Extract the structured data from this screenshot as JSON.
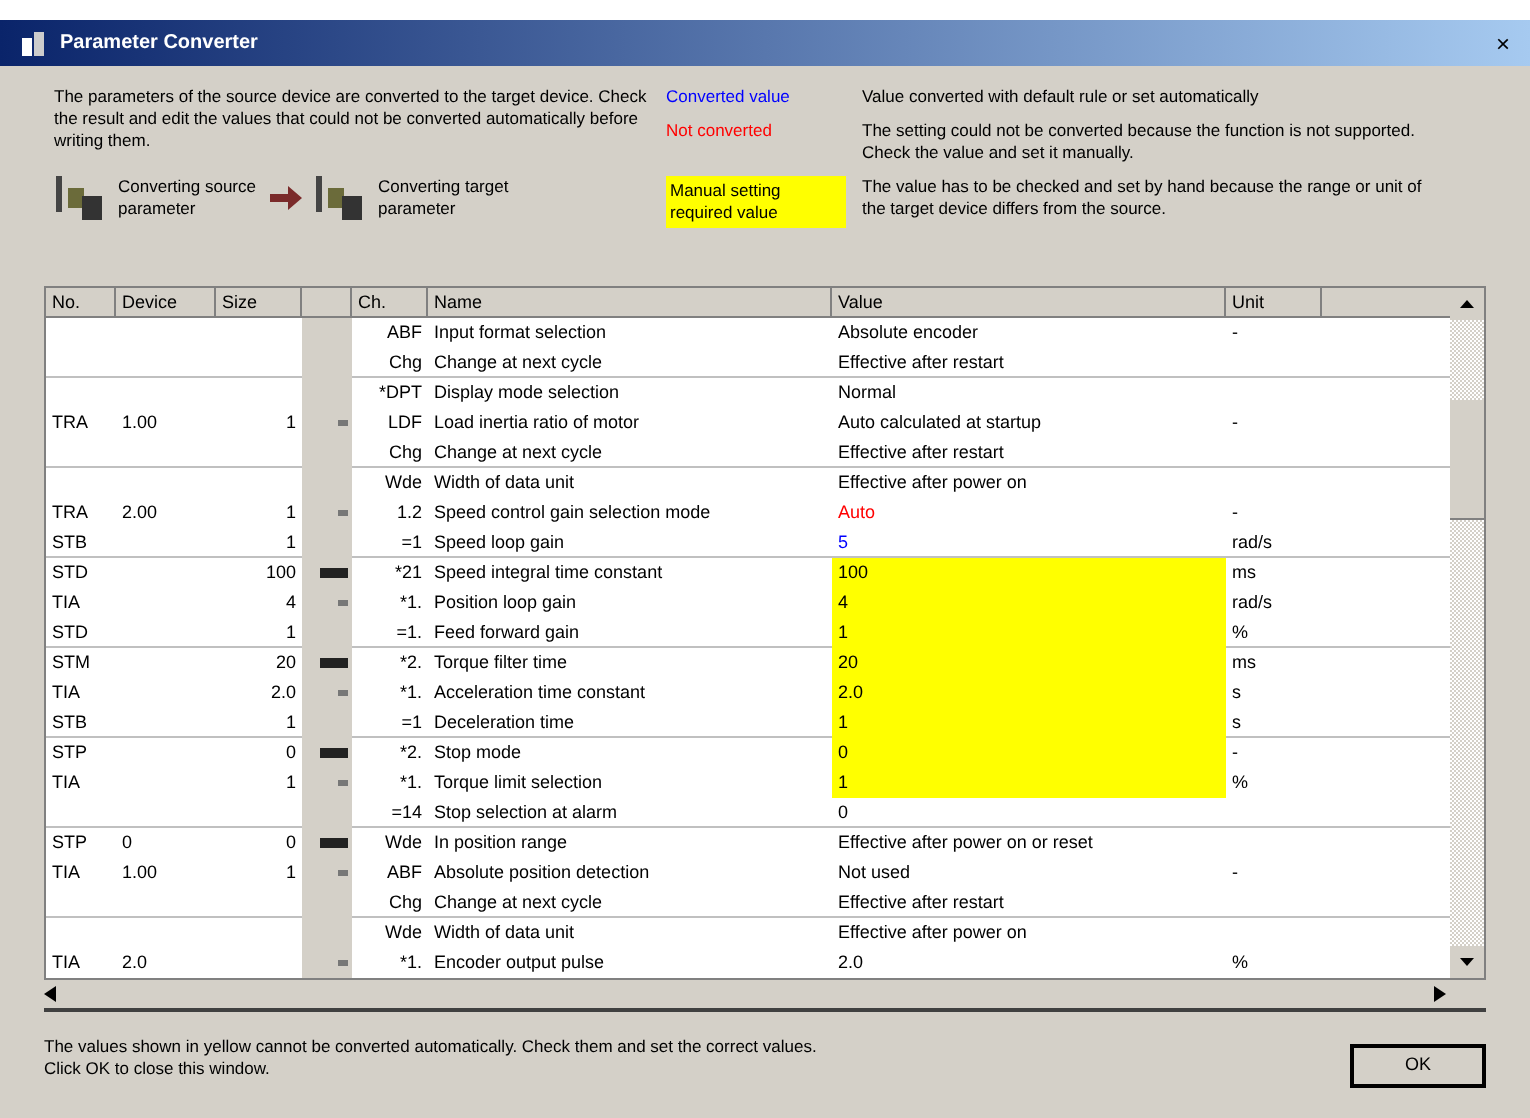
{
  "window": {
    "title": "Parameter Converter",
    "close": "×"
  },
  "description": "The parameters of the source device are converted to the target device. Check the result and edit the values that could not be converted automatically before writing them.",
  "source": {
    "label": "Converting source parameter"
  },
  "target": {
    "label": "Converting target parameter"
  },
  "legend": [
    {
      "kind": "converted",
      "label": "Converted value",
      "note": "Value converted with default rule or set automatically"
    },
    {
      "kind": "not_converted",
      "label": "Not converted",
      "note": "The setting could not be converted because the function is not supported. Check the value and set it manually."
    },
    {
      "kind": "manual",
      "label": "Manual setting\nrequired value",
      "note": "The value has to be checked and set by hand because the range or unit of the target device differs from the source."
    }
  ],
  "table": {
    "columns": [
      "No.",
      "Device",
      "Size",
      "",
      "Ch.",
      "Name",
      "Value",
      "Unit"
    ],
    "rows": [
      {
        "no": "",
        "device": "",
        "size": "",
        "marked": false,
        "ch": "ABF",
        "name": "Input format selection",
        "value": "Absolute encoder",
        "unit": "-",
        "kind": "normal",
        "group_end": false
      },
      {
        "no": "",
        "device": "",
        "size": "",
        "marked": false,
        "ch": "Chg",
        "name": "Change at next cycle",
        "value": "Effective after restart",
        "unit": "",
        "kind": "normal",
        "group_end": true
      },
      {
        "no": "",
        "device": "",
        "size": "",
        "marked": false,
        "ch": "*DPT",
        "name": "Display mode selection",
        "value": "Normal",
        "unit": "",
        "kind": "normal",
        "group_end": false
      },
      {
        "no": "TRA",
        "device": "1.00",
        "size": "1",
        "marked": true,
        "primary": false,
        "ch": "LDF",
        "name": "Load inertia ratio of motor",
        "value": "Auto calculated at startup",
        "unit": "-",
        "kind": "normal",
        "group_end": false
      },
      {
        "no": "",
        "device": "",
        "size": "",
        "marked": false,
        "ch": "Chg",
        "name": "Change at next cycle",
        "value": "Effective after restart",
        "unit": "",
        "kind": "normal",
        "group_end": true
      },
      {
        "no": "",
        "device": "",
        "size": "",
        "marked": false,
        "ch": "Wde",
        "name": "Width of data unit",
        "value": "Effective after power on",
        "unit": "",
        "kind": "normal",
        "group_end": false
      },
      {
        "no": "TRA",
        "device": "2.00",
        "size": "1",
        "marked": true,
        "primary": false,
        "ch": "1.2",
        "name": "Speed control gain selection mode",
        "value": "Auto",
        "unit": "-",
        "kind": "not_converted",
        "group_end": false
      },
      {
        "no": "STB",
        "device": "",
        "size": "1",
        "marked": false,
        "ch": "=1",
        "name": "Speed loop gain",
        "value": "5",
        "unit": "rad/s",
        "kind": "converted",
        "group_end": true
      },
      {
        "no": "STD",
        "device": "",
        "size": "100",
        "marked": true,
        "primary": true,
        "ch": "*21",
        "name": "Speed integral time constant",
        "value": "100",
        "unit": "ms",
        "kind": "manual",
        "group_end": false
      },
      {
        "no": "TIA",
        "device": "",
        "size": "4",
        "marked": true,
        "primary": false,
        "ch": "*1.",
        "name": "Position loop gain",
        "value": "4",
        "unit": "rad/s",
        "kind": "manual",
        "group_end": false
      },
      {
        "no": "STD",
        "device": "",
        "size": "1",
        "marked": false,
        "ch": "=1.",
        "name": "Feed forward gain",
        "value": "1",
        "unit": "%",
        "kind": "manual",
        "group_end": true
      },
      {
        "no": "STM",
        "device": "",
        "size": "20",
        "marked": true,
        "primary": true,
        "ch": "*2.",
        "name": "Torque filter time",
        "value": "20",
        "unit": "ms",
        "kind": "manual",
        "group_end": false
      },
      {
        "no": "TIA",
        "device": "",
        "size": "2.0",
        "marked": true,
        "primary": false,
        "ch": "*1.",
        "name": "Acceleration time constant",
        "value": "2.0",
        "unit": "s",
        "kind": "manual",
        "group_end": false
      },
      {
        "no": "STB",
        "device": "",
        "size": "1",
        "marked": false,
        "ch": "=1",
        "name": "Deceleration time",
        "value": "1",
        "unit": "s",
        "kind": "manual",
        "group_end": true
      },
      {
        "no": "STP",
        "device": "",
        "size": "0",
        "marked": true,
        "primary": true,
        "ch": "*2.",
        "name": "Stop mode",
        "value": "0",
        "unit": "-",
        "kind": "manual",
        "group_end": false
      },
      {
        "no": "TIA",
        "device": "",
        "size": "1",
        "marked": true,
        "primary": false,
        "ch": "*1.",
        "name": "Torque limit selection",
        "value": "1",
        "unit": "%",
        "kind": "manual",
        "group_end": false
      },
      {
        "no": "",
        "device": "",
        "size": "",
        "marked": false,
        "ch": "=14",
        "name": "Stop selection at alarm",
        "value": "0",
        "unit": "",
        "kind": "normal",
        "group_end": true
      },
      {
        "no": "STP",
        "device": "0",
        "size": "0",
        "marked": true,
        "primary": true,
        "ch": "Wde",
        "name": "In position range",
        "value": "Effective after power on or reset",
        "unit": "",
        "kind": "normal",
        "group_end": false
      },
      {
        "no": "TIA",
        "device": "1.00",
        "size": "1",
        "marked": true,
        "primary": false,
        "ch": "ABF",
        "name": "Absolute position detection",
        "value": "Not used",
        "unit": "-",
        "kind": "normal",
        "group_end": false
      },
      {
        "no": "",
        "device": "",
        "size": "",
        "marked": false,
        "ch": "Chg",
        "name": "Change at next cycle",
        "value": "Effective after restart",
        "unit": "",
        "kind": "normal",
        "group_end": true
      },
      {
        "no": "",
        "device": "",
        "size": "",
        "marked": false,
        "ch": "Wde",
        "name": "Width of data unit",
        "value": "Effective after power on",
        "unit": "",
        "kind": "normal",
        "group_end": false
      },
      {
        "no": "TIA",
        "device": "2.0",
        "size": "",
        "marked": true,
        "primary": false,
        "ch": "*1.",
        "name": "Encoder output pulse",
        "value": "2.0",
        "unit": "%",
        "kind": "normal",
        "group_end": false
      }
    ]
  },
  "footer": "The values shown in yellow cannot be converted automatically. Check them and set the correct values.\nClick OK to close this window.",
  "ok_button": "OK"
}
